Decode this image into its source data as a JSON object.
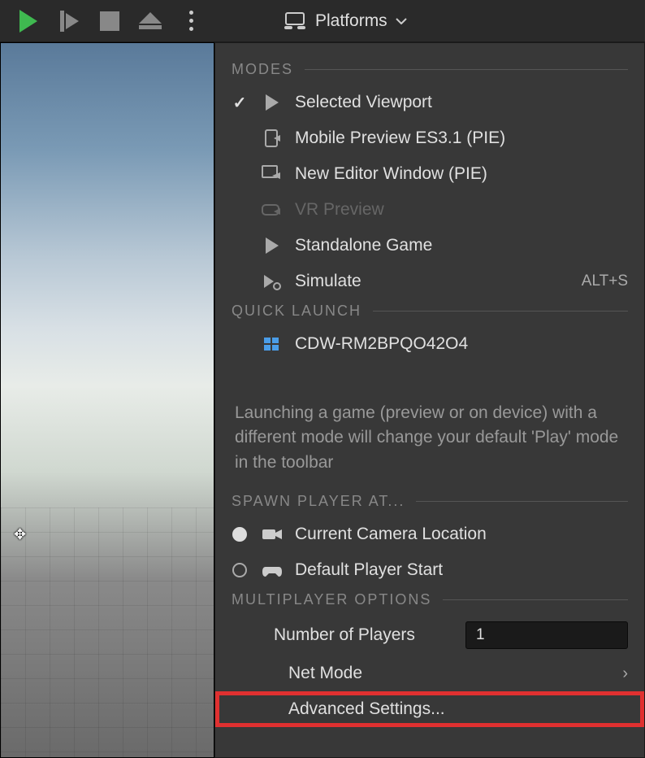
{
  "toolbar": {
    "platforms_label": "Platforms"
  },
  "menu": {
    "modes_header": "MODES",
    "modes": {
      "selected_viewport": "Selected Viewport",
      "mobile_preview": "Mobile Preview ES3.1 (PIE)",
      "new_editor_window": "New Editor Window (PIE)",
      "vr_preview": "VR Preview",
      "standalone_game": "Standalone Game",
      "simulate": "Simulate",
      "simulate_shortcut": "ALT+S"
    },
    "quick_launch_header": "QUICK LAUNCH",
    "quick_launch_device": "CDW-RM2BPQO42O4",
    "info_text": "Launching a game (preview or on device) with a different mode will change your default 'Play' mode in the toolbar",
    "spawn_header": "SPAWN PLAYER AT...",
    "spawn": {
      "current_camera": "Current Camera Location",
      "default_start": "Default Player Start"
    },
    "multiplayer_header": "MULTIPLAYER OPTIONS",
    "multiplayer": {
      "number_of_players_label": "Number of Players",
      "number_of_players_value": "1",
      "net_mode": "Net Mode",
      "advanced_settings": "Advanced Settings..."
    }
  }
}
